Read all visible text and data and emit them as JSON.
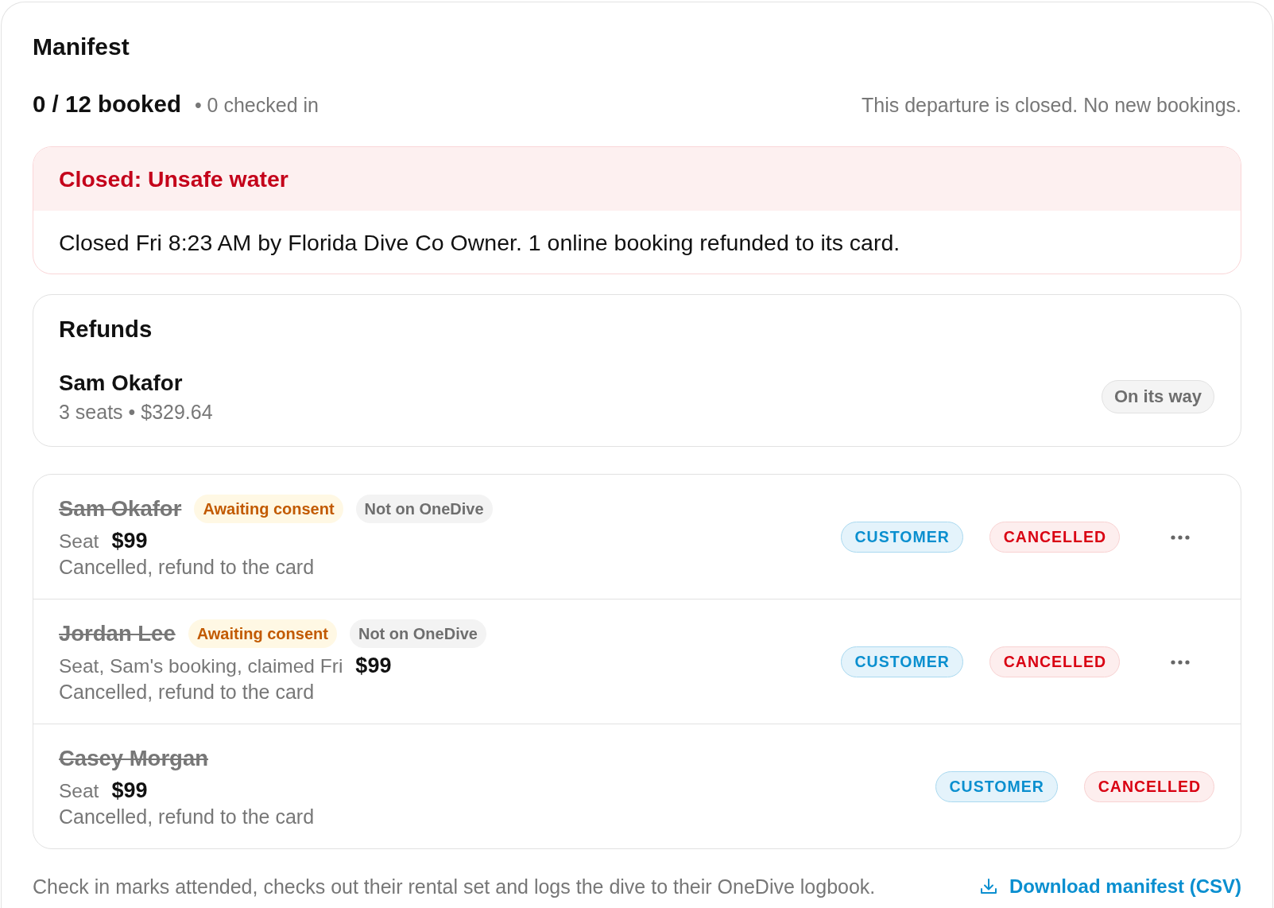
{
  "header": {
    "title": "Manifest",
    "booked": "0 / 12 booked",
    "checked_in": "• 0 checked in",
    "notice": "This departure is closed. No new bookings."
  },
  "closure": {
    "title": "Closed: Unsafe water",
    "message": "Closed Fri 8:23 AM by Florida Dive Co Owner. 1 online booking refunded to its card."
  },
  "refunds": {
    "title": "Refunds",
    "items": [
      {
        "name": "Sam Okafor",
        "detail": "3 seats • $329.64",
        "status": "On its way"
      }
    ]
  },
  "bookings": [
    {
      "name": "Sam Okafor",
      "cancelled": true,
      "tags": [
        {
          "label": "Awaiting consent",
          "kind": "warning"
        },
        {
          "label": "Not on OneDive",
          "kind": "neutral"
        }
      ],
      "seat": "Seat",
      "price": "$99",
      "status": "Cancelled, refund to the card",
      "badges": [
        {
          "label": "CUSTOMER",
          "kind": "info"
        },
        {
          "label": "CANCELLED",
          "kind": "danger"
        }
      ],
      "menu": true
    },
    {
      "name": "Jordan Lee",
      "cancelled": true,
      "tags": [
        {
          "label": "Awaiting consent",
          "kind": "warning"
        },
        {
          "label": "Not on OneDive",
          "kind": "neutral"
        }
      ],
      "seat": "Seat, Sam's booking, claimed Fri",
      "price": "$99",
      "status": "Cancelled, refund to the card",
      "badges": [
        {
          "label": "CUSTOMER",
          "kind": "info"
        },
        {
          "label": "CANCELLED",
          "kind": "danger"
        }
      ],
      "menu": true
    },
    {
      "name": "Casey Morgan",
      "cancelled": true,
      "seat": "Seat",
      "price": "$99",
      "status": "Cancelled, refund to the card",
      "badges": [
        {
          "label": "CUSTOMER",
          "kind": "info"
        },
        {
          "label": "CANCELLED",
          "kind": "danger"
        }
      ],
      "menu": false
    }
  ],
  "footer": {
    "note": "Check in marks attended, checks out their rental set and logs the dive to their OneDive logbook.",
    "download": "Download manifest (CSV)"
  }
}
